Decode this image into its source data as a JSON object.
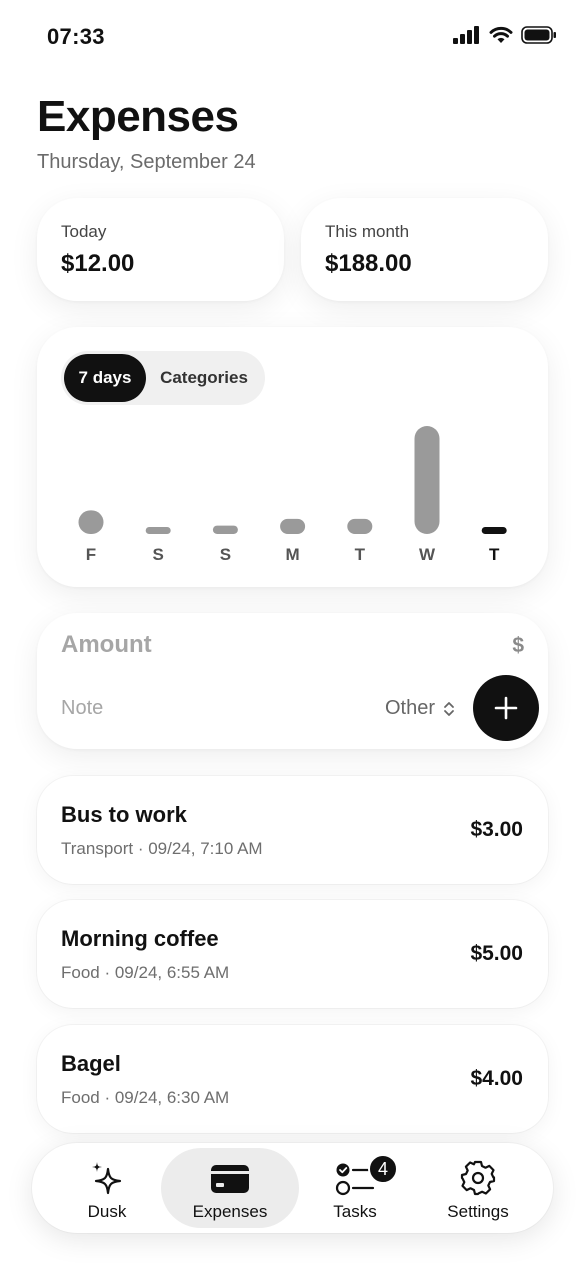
{
  "status_bar": {
    "time": "07:33"
  },
  "header": {
    "title": "Expenses",
    "date": "Thursday, September 24"
  },
  "summary": {
    "today": {
      "label": "Today",
      "value": "$12.00"
    },
    "month": {
      "label": "This month",
      "value": "$188.00"
    }
  },
  "chart_controls": {
    "active": "7 days",
    "inactive": "Categories"
  },
  "chart_data": {
    "type": "bar",
    "categories": [
      "F",
      "S",
      "S",
      "M",
      "T",
      "W",
      "T"
    ],
    "values": [
      14,
      2,
      5,
      9,
      9,
      64,
      4
    ],
    "highlight_index": 6,
    "colors": {
      "normal": "#9a9a9a",
      "highlight": "#111111"
    }
  },
  "entry": {
    "amount_placeholder": "Amount",
    "currency": "$",
    "note_placeholder": "Note",
    "category": "Other"
  },
  "expenses": [
    {
      "name": "Bus to work",
      "meta": "Transport · 09/24, 7:10 AM",
      "amount": "$3.00"
    },
    {
      "name": "Morning coffee",
      "meta": "Food · 09/24, 6:55 AM",
      "amount": "$5.00"
    },
    {
      "name": "Bagel",
      "meta": "Food · 09/24, 6:30 AM",
      "amount": "$4.00"
    }
  ],
  "tabs": [
    {
      "label": "Dusk",
      "icon": "sparkles-icon"
    },
    {
      "label": "Expenses",
      "icon": "credit-card-icon",
      "active": true
    },
    {
      "label": "Tasks",
      "icon": "checklist-icon",
      "badge": "4"
    },
    {
      "label": "Settings",
      "icon": "gear-icon"
    }
  ]
}
